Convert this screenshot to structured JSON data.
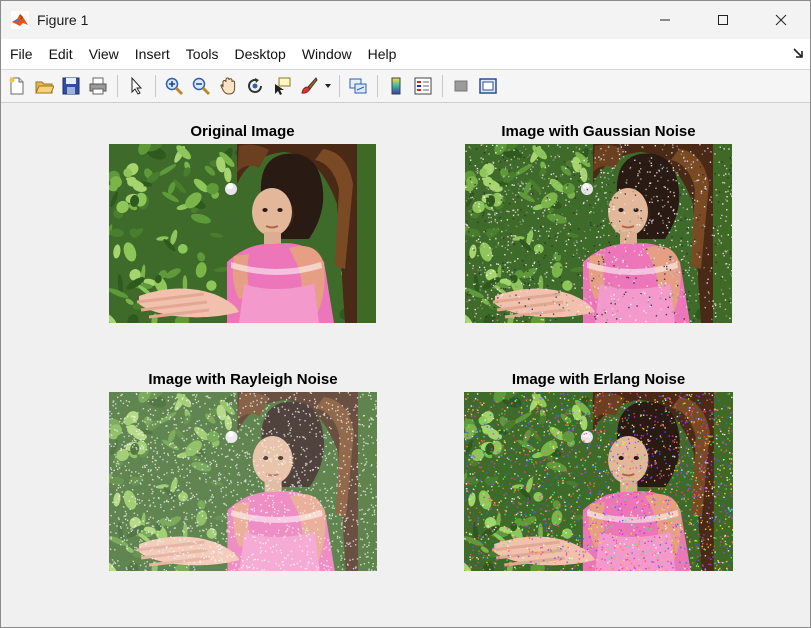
{
  "window": {
    "title": "Figure 1",
    "icon": "matlab-logo-icon",
    "controls": [
      "minimize-icon",
      "maximize-icon",
      "close-icon"
    ]
  },
  "menubar": {
    "items": [
      "File",
      "Edit",
      "View",
      "Insert",
      "Tools",
      "Desktop",
      "Window",
      "Help"
    ],
    "dock_icon": "dock-arrow-icon"
  },
  "toolbar": {
    "buttons": [
      "new-figure-icon",
      "open-file-icon",
      "save-icon",
      "print-icon",
      "edit-plot-arrow-icon",
      "zoom-in-icon",
      "zoom-out-icon",
      "pan-hand-icon",
      "rotate-3d-icon",
      "data-cursor-icon",
      "brush-icon",
      "link-plot-icon",
      "colorbar-icon",
      "legend-icon",
      "hide-plot-tools-icon",
      "show-plot-tools-icon"
    ]
  },
  "subplots": [
    {
      "title": "Original Image",
      "noise": "none"
    },
    {
      "title": "Image with Gaussian Noise",
      "noise": "gaussian"
    },
    {
      "title": "Image with Rayleigh Noise",
      "noise": "rayleigh"
    },
    {
      "title": "Image with Erlang Noise",
      "noise": "erlang"
    }
  ]
}
